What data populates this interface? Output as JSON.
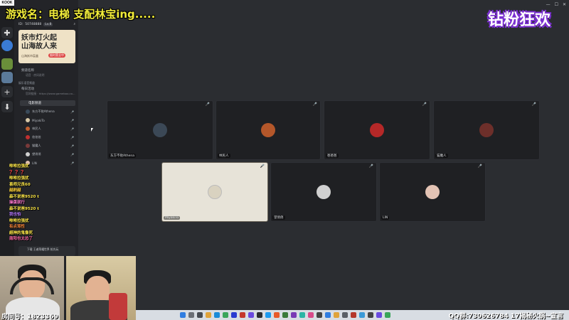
{
  "overlay": {
    "game_title": "游戏名：电梯 支配林宝ing.....",
    "right_title": "钻粉狂欢",
    "brand": "KOOK"
  },
  "sidebar": {
    "server_id_label": "ID：50748888",
    "level": "Lv.8",
    "banner": {
      "line1": "妖市灯火起",
      "line2": "山海故人来",
      "caption": "山海妖市盲盒",
      "badge": "限时营业中"
    },
    "items": [
      {
        "label": "频道名称",
        "sub": "语音 · 房间说明"
      },
      {
        "label": "每日活动",
        "sub": "官网链接 · https://www.gameboo.co..."
      }
    ],
    "category": "娱乐语音频道",
    "voice_channel": "电影频道",
    "members": [
      {
        "name": "东方不败Athena",
        "color": "#3a4a5a"
      },
      {
        "name": "MiyakiTo",
        "color": "#d8c9a8"
      },
      {
        "name": "林民人",
        "color": "#c06030"
      },
      {
        "name": "爸爸爸",
        "color": "#c03030"
      },
      {
        "name": "猫魔人",
        "color": "#7a3a3a"
      },
      {
        "name": "望俏俏",
        "color": "#cfcfcf"
      },
      {
        "name": "LIN",
        "color": "#e0c0b0"
      }
    ],
    "promo": "下载 王者荣耀世界 抢先玩"
  },
  "tiles": [
    {
      "name": "东方不败Athena",
      "color": "#3b4856"
    },
    {
      "name": "林民人",
      "color": "#b4572a"
    },
    {
      "name": "爸爸爸",
      "color": "#b52828"
    },
    {
      "name": "猫魔人",
      "color": "#6d2f2a"
    },
    {
      "name": "MiyakiTo",
      "color": "#d9d2c0"
    },
    {
      "name": "望俏俏",
      "color": "#d0d0d0"
    },
    {
      "name": "LIN",
      "color": "#e3c3b4"
    }
  ],
  "chat": [
    {
      "text": "咻咻拉强扰",
      "color": "#ffe94a"
    },
    {
      "text": "？？？",
      "color": "#ff4a4a"
    },
    {
      "text": "咻咻拉强扰",
      "color": "#ffe94a"
    },
    {
      "text": "喜师兄良60",
      "color": "#ffe94a"
    },
    {
      "text": "越刷越",
      "color": "#ffd23a"
    },
    {
      "text": "森不说爸9520 t",
      "color": "#ffe94a"
    },
    {
      "text": "操蛋就行",
      "color": "#ff7ad0"
    },
    {
      "text": "森不说爸9520 t",
      "color": "#ffe94a"
    },
    {
      "text": "我也怕",
      "color": "#b67aff"
    },
    {
      "text": "咻咻拉强扰",
      "color": "#ffe94a"
    },
    {
      "text": "有点骂性",
      "color": "#ff8a3a"
    },
    {
      "text": "超神的鬼像死",
      "color": "#ffe94a"
    },
    {
      "text": "南阳也太怂了",
      "color": "#ff6aa8"
    }
  ],
  "webcam_label": "房间号：1823369",
  "qq_text": "QQ群:730626784  17揭秘火锅~宣言"
}
